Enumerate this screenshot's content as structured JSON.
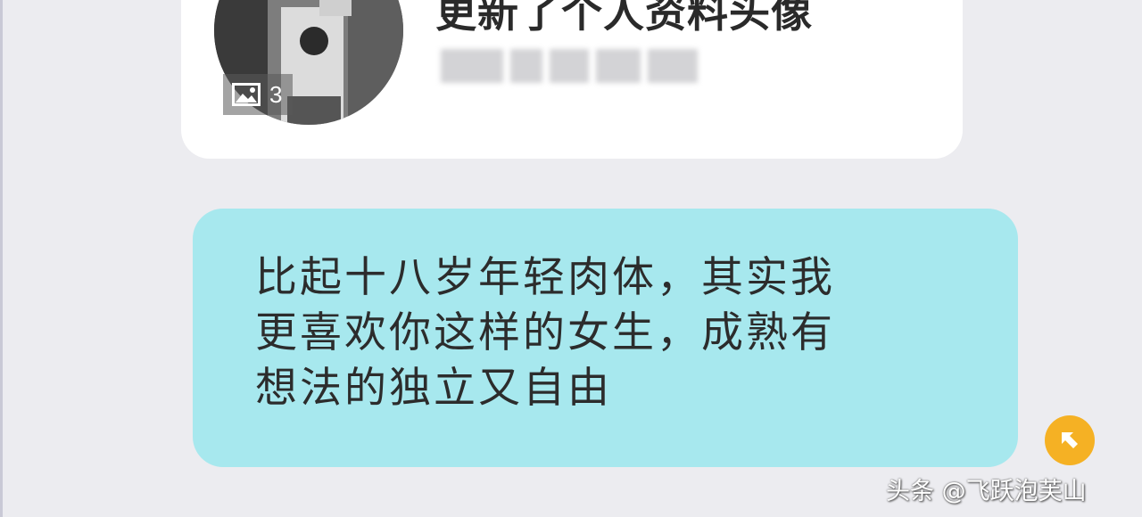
{
  "card": {
    "title": "更新了个人资料头像",
    "photo_count": "3"
  },
  "message": {
    "text": "比起十八岁年轻肉体，其实我\n更喜欢你这样的女生，成熟有\n想法的独立又自由"
  },
  "watermark": "头条 @飞跃泡芙山",
  "icons": {
    "photo_count": "image-icon",
    "jump_button": "arrow-up-left-icon"
  },
  "colors": {
    "bubble": "#a7e8ee",
    "card": "#ffffff",
    "background": "#ececf0",
    "jump_button": "#f5b124"
  }
}
